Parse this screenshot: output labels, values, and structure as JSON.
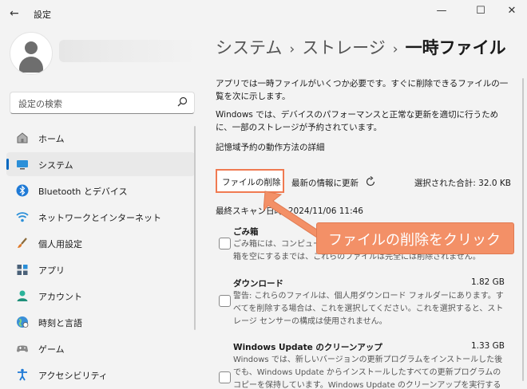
{
  "window": {
    "title": "設定",
    "back_icon": "back-arrow-icon"
  },
  "search": {
    "placeholder": "設定の検索"
  },
  "nav": {
    "items": [
      {
        "label": "ホーム",
        "icon": "home-icon"
      },
      {
        "label": "システム",
        "icon": "system-icon",
        "active": true
      },
      {
        "label": "Bluetooth とデバイス",
        "icon": "bluetooth-icon"
      },
      {
        "label": "ネットワークとインターネット",
        "icon": "wifi-icon"
      },
      {
        "label": "個人用設定",
        "icon": "brush-icon"
      },
      {
        "label": "アプリ",
        "icon": "apps-icon"
      },
      {
        "label": "アカウント",
        "icon": "account-icon"
      },
      {
        "label": "時刻と言語",
        "icon": "globe-icon"
      },
      {
        "label": "ゲーム",
        "icon": "gamepad-icon"
      },
      {
        "label": "アクセシビリティ",
        "icon": "accessibility-icon"
      }
    ]
  },
  "breadcrumb": {
    "level1": "システム",
    "sep1": "›",
    "level2": "ストレージ",
    "sep2": "›",
    "current": "一時ファイル"
  },
  "intro": {
    "line1": "アプリでは一時ファイルがいくつか必要です。すぐに削除できるファイルの一覧を次に示します。",
    "line2": "Windows では、デバイスのパフォーマンスと正常な更新を適切に行うために、一部のストレージが予約されています。",
    "link": "記憶域予約の動作方法の詳細"
  },
  "actions": {
    "delete_label": "ファイルの削除",
    "refresh_label": "最新の情報に更新",
    "total": "選択された合計: 32.0 KB"
  },
  "scan": {
    "label": "最終スキャン日時: 2024/11/06 11:46"
  },
  "items": [
    {
      "title": "ごみ箱",
      "size": "",
      "desc": "ごみ箱には、コンピューターから削除したファイルが含まれています。ごみ箱を空にするまでは、これらのファイルは完全には削除されません。"
    },
    {
      "title": "ダウンロード",
      "size": "1.82 GB",
      "desc": "警告: これらのファイルは、個人用ダウンロード フォルダーにあります。すべてを削除する場合は、これを選択してください。これを選択すると、ストレージ センサーの構成は使用されません。"
    },
    {
      "title": "Windows Update のクリーンアップ",
      "size": "1.33 GB",
      "desc": "Windows では、新しいバージョンの更新プログラムをインストールした後でも、Windows Update からインストールしたすべての更新プログラムのコピーを保持しています。Windows Update のクリーンアップを実行すると、領域を占"
    }
  ],
  "annotation": {
    "text": "ファイルの削除をクリック",
    "color": "#f39067"
  },
  "colors": {
    "accent": "#0067c0",
    "highlight_border": "#f07a51"
  }
}
